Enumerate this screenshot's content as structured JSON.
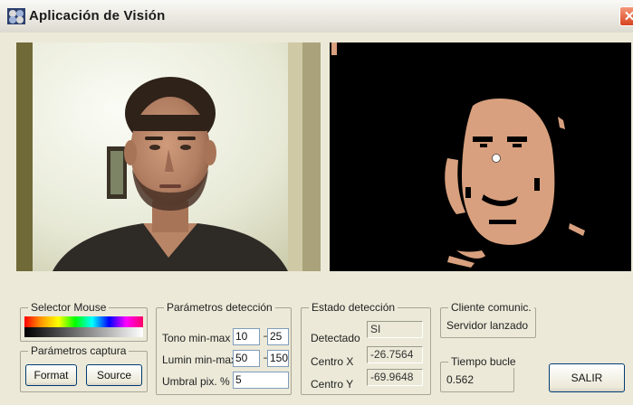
{
  "window": {
    "title": "Aplicación de Visión",
    "close_glyph": "✕",
    "app_icon": "app-icon"
  },
  "views": {
    "camera": "webcam-face-image",
    "segmentation": "skin-segmentation-mask"
  },
  "selector_mouse": {
    "title": "Selector Mouse"
  },
  "parametros_captura": {
    "title": "Parámetros captura",
    "format_label": "Format",
    "source_label": "Source"
  },
  "parametros_deteccion": {
    "title": "Parámetros detección",
    "tono_label": "Tono min-max",
    "tono_min": "10",
    "tono_max": "25",
    "lumin_label": "Lumin min-max",
    "lumin_min": "50",
    "lumin_max": "150",
    "umbral_label": "Umbral pix. %",
    "umbral": "5",
    "range_sep": "–"
  },
  "estado_deteccion": {
    "title": "Estado detección",
    "detectado_label": "Detectado",
    "detectado_value": "SI",
    "centro_x_label": "Centro X",
    "centro_x_value": "-26.7564",
    "centro_y_label": "Centro Y",
    "centro_y_value": "-69.9648"
  },
  "cliente_comunic": {
    "title": "Cliente comunic.",
    "status": "Servidor lanzado"
  },
  "tiempo_bucle": {
    "title": "Tiempo bucle",
    "value": "0.562"
  },
  "salir_label": "SALIR",
  "colors": {
    "skin_mask": "#d8a07e",
    "titlebar": "#ece9d8",
    "close_button": "#d8431f"
  }
}
